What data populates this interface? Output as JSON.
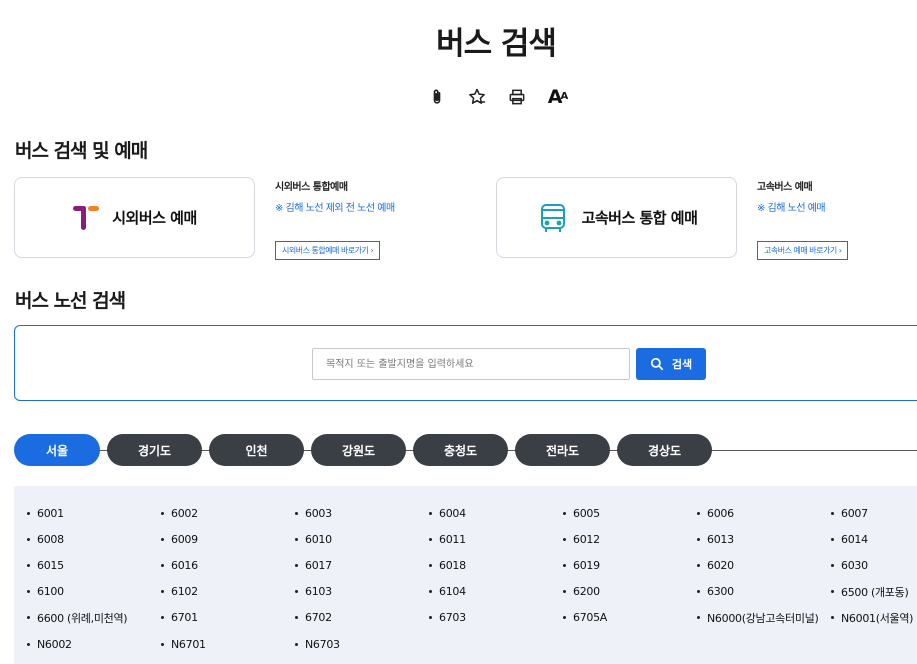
{
  "page": {
    "title": "버스 검색"
  },
  "toolbar": {
    "icons": [
      "clip-icon",
      "star-icon",
      "print-icon",
      "font-size-icon"
    ],
    "font_label_big": "A",
    "font_label_small": "A"
  },
  "reservation": {
    "title": "버스 검색 및 예매",
    "intercity": {
      "label": "시외버스 예매",
      "info_title": "시외버스 통합예매",
      "info_note": "※ 김해 노선 제외 전 노선 예매",
      "link_label": "시외버스 통합예매 바로가기"
    },
    "express": {
      "label": "고속버스 통합 예매",
      "info_title": "고속버스 예매",
      "info_note": "※ 김해 노선 예매",
      "link_label": "고속버스 예매 바로가기"
    }
  },
  "route_search": {
    "title": "버스 노선 검색",
    "placeholder": "목적지 또는 출발지명을 입력하세요",
    "button_label": "검색"
  },
  "regions": [
    "서울",
    "경기도",
    "인천",
    "강원도",
    "충청도",
    "전라도",
    "경상도"
  ],
  "active_region": "서울",
  "routes": [
    "6001",
    "6002",
    "6003",
    "6004",
    "6005",
    "6006",
    "6007",
    "6008",
    "6009",
    "6010",
    "6011",
    "6012",
    "6013",
    "6014",
    "6015",
    "6016",
    "6017",
    "6018",
    "6019",
    "6020",
    "6030",
    "6100",
    "6102",
    "6103",
    "6104",
    "6200",
    "6300",
    "6500 (개포동)",
    "6600 (위례,미천역)",
    "6701",
    "6702",
    "6703",
    "6705A",
    "N6000(강남고속터미널)",
    "N6001(서울역)",
    "N6002",
    "N6701",
    "N6703"
  ],
  "colors": {
    "accent": "#1a6ce0",
    "tab_dark": "#3a3f46",
    "panel_bg": "#eef2f8"
  }
}
